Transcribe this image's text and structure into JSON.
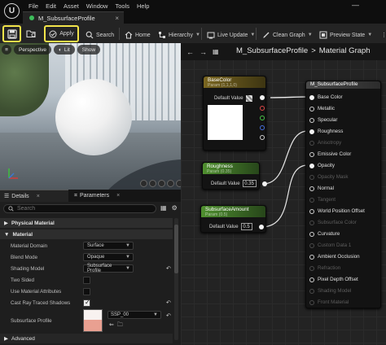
{
  "menubar": {
    "logo": "U",
    "items": [
      "File",
      "Edit",
      "Asset",
      "Window",
      "Tools",
      "Help"
    ],
    "tab_title": "M_SubsurfaceProfile",
    "tab_close": "×",
    "minimize": "—"
  },
  "toolbar": {
    "apply_label": "Apply",
    "search_label": "Search",
    "home_label": "Home",
    "hierarchy_label": "Hierarchy",
    "live_update_label": "Live Update",
    "clean_graph_label": "Clean Graph",
    "preview_state_label": "Preview State"
  },
  "viewport": {
    "perspective_label": "Perspective",
    "lit_label": "Lit",
    "show_label": "Show"
  },
  "details": {
    "tab_details": "Details",
    "tab_parameters": "Parameters",
    "search_placeholder": "Search",
    "sections": {
      "physical_material": "Physical Material",
      "material": "Material",
      "advanced": "Advanced"
    },
    "props": {
      "material_domain": {
        "label": "Material Domain",
        "value": "Surface"
      },
      "blend_mode": {
        "label": "Blend Mode",
        "value": "Opaque"
      },
      "shading_model": {
        "label": "Shading Model",
        "value": "Subsurface Profile"
      },
      "two_sided": {
        "label": "Two Sided",
        "checked": false
      },
      "use_material_attributes": {
        "label": "Use Material Attributes",
        "checked": false
      },
      "cast_ray_traced_shadows": {
        "label": "Cast Ray Traced Shadows",
        "checked": true
      },
      "subsurface_profile": {
        "label": "Subsurface Profile",
        "value": "SSP_00"
      }
    }
  },
  "graph": {
    "path_root": "M_SubsurfaceProfile",
    "path_sep": ">",
    "path_leaf": "Material Graph",
    "nodes": {
      "base_color": {
        "title": "BaseColor",
        "subtitle": "Param (1,1,1,0)",
        "default_label": "Default Value",
        "color": "#f0f0f0"
      },
      "roughness": {
        "title": "Roughness",
        "subtitle": "Param (0.35)",
        "default_label": "Default Value",
        "value": "0.35"
      },
      "subsurface_amount": {
        "title": "SubsurfaceAmount",
        "subtitle": "Param (0.5)",
        "default_label": "Default Value",
        "value": "0.5"
      },
      "result": {
        "title": "M_SubsurfaceProfile",
        "pins": [
          {
            "label": "Base Color",
            "enabled": true,
            "connected": true
          },
          {
            "label": "Metallic",
            "enabled": true,
            "connected": false
          },
          {
            "label": "Specular",
            "enabled": true,
            "connected": false
          },
          {
            "label": "Roughness",
            "enabled": true,
            "connected": true
          },
          {
            "label": "Anisotropy",
            "enabled": false,
            "connected": false
          },
          {
            "label": "Emissive Color",
            "enabled": true,
            "connected": false
          },
          {
            "label": "Opacity",
            "enabled": true,
            "connected": true
          },
          {
            "label": "Opacity Mask",
            "enabled": false,
            "connected": false
          },
          {
            "label": "Normal",
            "enabled": true,
            "connected": false
          },
          {
            "label": "Tangent",
            "enabled": false,
            "connected": false
          },
          {
            "label": "World Position Offset",
            "enabled": true,
            "connected": false
          },
          {
            "label": "Subsurface Color",
            "enabled": false,
            "connected": false
          },
          {
            "label": "Curvature",
            "enabled": true,
            "connected": false
          },
          {
            "label": "Custom Data 1",
            "enabled": false,
            "connected": false
          },
          {
            "label": "Ambient Occlusion",
            "enabled": true,
            "connected": false
          },
          {
            "label": "Refraction",
            "enabled": false,
            "connected": false
          },
          {
            "label": "Pixel Depth Offset",
            "enabled": true,
            "connected": false
          },
          {
            "label": "Shading Model",
            "enabled": false,
            "connected": false
          },
          {
            "label": "Front Material",
            "enabled": false,
            "connected": false
          }
        ]
      }
    }
  },
  "colors": {
    "accent_highlight": "#f2e44a",
    "param_vector_header": "#6b5a1a",
    "param_scalar_header": "#3e7a2a",
    "result_header": "#3a3a3a",
    "tab_dot": "#3dbd5b",
    "subsurface_preview": "#e9a091"
  }
}
